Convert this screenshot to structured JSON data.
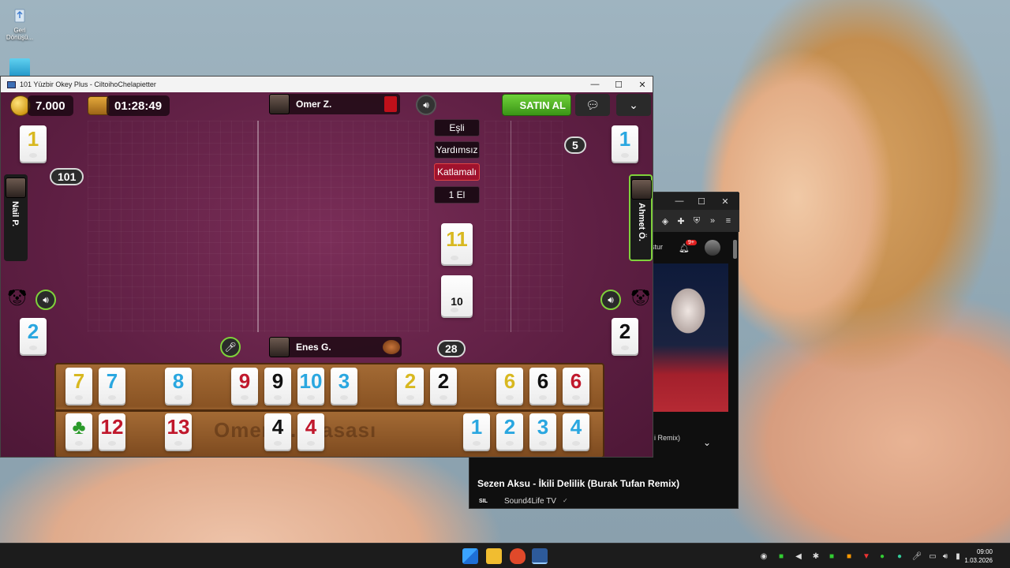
{
  "desktop": {
    "recycle_bin_label": "Geri Dönüşü...",
    "icon2_label": ""
  },
  "game_window": {
    "title": "101 Yüzbir Okey Plus - CiltoihoChelapietter",
    "controls": {
      "minimize": "—",
      "maximize": "☐",
      "close": "✕"
    },
    "hud": {
      "coins": "7.000",
      "timer": "01:28:49",
      "buy_button": "SATIN AL",
      "top_player": "Omer Z.",
      "bottom_player": "Enes G.",
      "left_player": "Nail P.",
      "right_player": "Ahmet Ö."
    },
    "options": [
      "Eşli",
      "Yardımsız",
      "Katlamalı",
      "1 El"
    ],
    "active_option_index": 2,
    "indicators": {
      "left_top_tile": "1",
      "left_bottom_tile": "2",
      "right_top_tile": "1",
      "right_bottom_tile": "2",
      "left_score": "101",
      "right_score": "5",
      "deck_count": "28",
      "center_tile": "11",
      "center_deck_label": "10"
    },
    "rack": {
      "watermark": "Omer Z. Masası",
      "row1": [
        {
          "v": "7",
          "c": "yellow"
        },
        {
          "v": "7",
          "c": "blue"
        },
        {
          "v": "8",
          "c": "blue"
        },
        {
          "v": "9",
          "c": "red"
        },
        {
          "v": "9",
          "c": "black"
        },
        {
          "v": "10",
          "c": "blue"
        },
        {
          "v": "3",
          "c": "blue"
        },
        {
          "v": "2",
          "c": "yellow"
        },
        {
          "v": "2",
          "c": "black"
        },
        {
          "v": "6",
          "c": "yellow"
        },
        {
          "v": "6",
          "c": "black"
        },
        {
          "v": "6",
          "c": "red"
        }
      ],
      "row2": [
        {
          "v": "♣",
          "c": "green"
        },
        {
          "v": "12",
          "c": "red"
        },
        {
          "v": "13",
          "c": "red"
        },
        {
          "v": "4",
          "c": "black"
        },
        {
          "v": "4",
          "c": "red"
        },
        {
          "v": "1",
          "c": "blue"
        },
        {
          "v": "2",
          "c": "blue"
        },
        {
          "v": "3",
          "c": "blue"
        },
        {
          "v": "4",
          "c": "blue"
        }
      ]
    }
  },
  "browser": {
    "search_partial": "ştur",
    "notification_count": "9+",
    "collapsed_title_partial": "i Remix)",
    "video_title": "Sezen Aksu - İkili Delilik (Burak Tufan Remix)",
    "channel_name": "Sound4Life TV",
    "verified_icon": "✓"
  },
  "taskbar": {
    "time": "09:00",
    "date": "1.03.2026"
  },
  "colors": {
    "board": "#5e1f43",
    "tile_yellow": "#d8b820",
    "tile_blue": "#2aa7e0",
    "tile_red": "#c0182c",
    "tile_black": "#111111",
    "buy_button": "#4caf1f",
    "active_option": "#a0122d"
  }
}
